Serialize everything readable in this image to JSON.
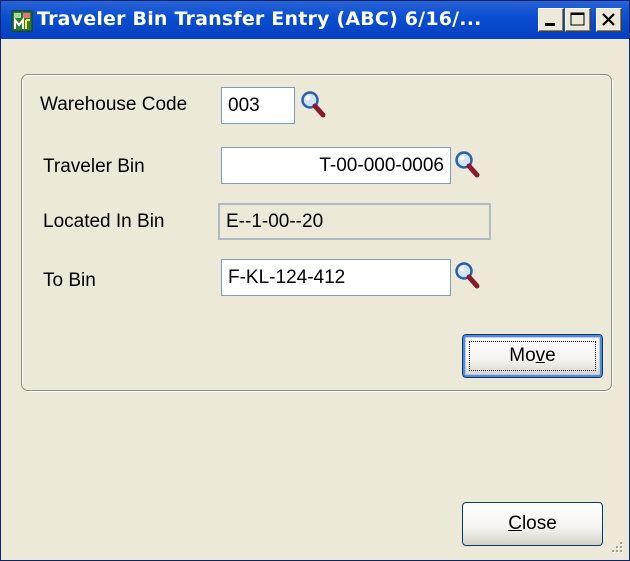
{
  "window": {
    "title": "Traveler Bin Transfer Entry (ABC) 6/16/...",
    "controls": [
      "minimize-icon",
      "maximize-icon",
      "close-icon"
    ]
  },
  "form": {
    "warehouse_code": {
      "label": "Warehouse Code",
      "value": "003"
    },
    "traveler_bin": {
      "label": "Traveler Bin",
      "value": "T-00-000-0006"
    },
    "located_in_bin": {
      "label": "Located In Bin",
      "value": "E--1-00--20"
    },
    "to_bin": {
      "label": "To Bin",
      "value": "F-KL-124-412"
    }
  },
  "buttons": {
    "move": {
      "pre": "Mo",
      "accel": "v",
      "post": "e"
    },
    "close": {
      "pre": "",
      "accel": "C",
      "post": "lose"
    }
  },
  "icons": {
    "lookup": "magnifier-icon",
    "app": "app-icon",
    "grip": "size-grip-icon"
  },
  "colors": {
    "title_bar": "#0a4fd2",
    "window_bg": "#ece9d8",
    "field_border": "#7f9db9",
    "button_border": "#003c74"
  }
}
